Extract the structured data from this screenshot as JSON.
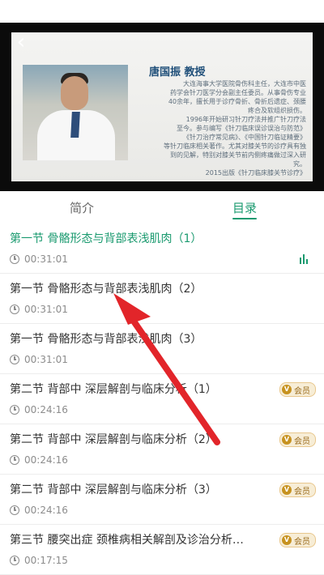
{
  "video": {
    "teacher": {
      "name_title": "唐国振 教授",
      "bio_lines": [
        "大连海事大学医院骨伤科主任，大连市中医",
        "药学会针刀医学分会副主任委员。从事骨伤专业",
        "40余年，擅长用于诊疗骨折、骨折后遗症、颈腰",
        "疼合及软组织损伤。",
        "1996年开始研习针刀疗法并推广针刀疗法",
        "至今。参与编写《针刀临床误诊误治与防范》",
        "《针刀治疗常见病》、《中国针刀临证精要》",
        "等针刀临床相关著作。尤其对膝关节的诊疗具有独",
        "到的见解，特别对膝关节前内侧疼痛做过深入研",
        "究。",
        "2015出版《针刀临床膝关节诊疗》"
      ]
    }
  },
  "tabs": {
    "intro": "简介",
    "catalog": "目录"
  },
  "lessons": [
    {
      "title": "第一节 骨骼形态与背部表浅肌肉（1）",
      "duration": "00:31:01",
      "active": true,
      "vip": false
    },
    {
      "title": "第一节 骨骼形态与背部表浅肌肉（2）",
      "duration": "00:31:01",
      "active": false,
      "vip": false
    },
    {
      "title": "第一节 骨骼形态与背部表浅肌肉（3）",
      "duration": "00:31:01",
      "active": false,
      "vip": false
    },
    {
      "title": "第二节 背部中 深层解剖与临床分析（1）",
      "duration": "00:24:16",
      "active": false,
      "vip": true
    },
    {
      "title": "第二节 背部中 深层解剖与临床分析（2）",
      "duration": "00:24:16",
      "active": false,
      "vip": true
    },
    {
      "title": "第二节 背部中 深层解剖与临床分析（3）",
      "duration": "00:24:16",
      "active": false,
      "vip": true
    },
    {
      "title": "第三节 腰突出症 颈椎病相关解剖及诊治分析…",
      "duration": "00:17:15",
      "active": false,
      "vip": true
    }
  ],
  "vip_badge": {
    "icon_letter": "V",
    "label": "会员"
  },
  "colors": {
    "accent": "#1a9a6f",
    "annotation_arrow": "#e2252a",
    "vip_gold": "#c7921f"
  },
  "icons": {
    "back": "chevron-left-icon",
    "duration": "clock-icon",
    "now_playing": "equalizer-icon",
    "vip": "vip-badge-icon"
  }
}
